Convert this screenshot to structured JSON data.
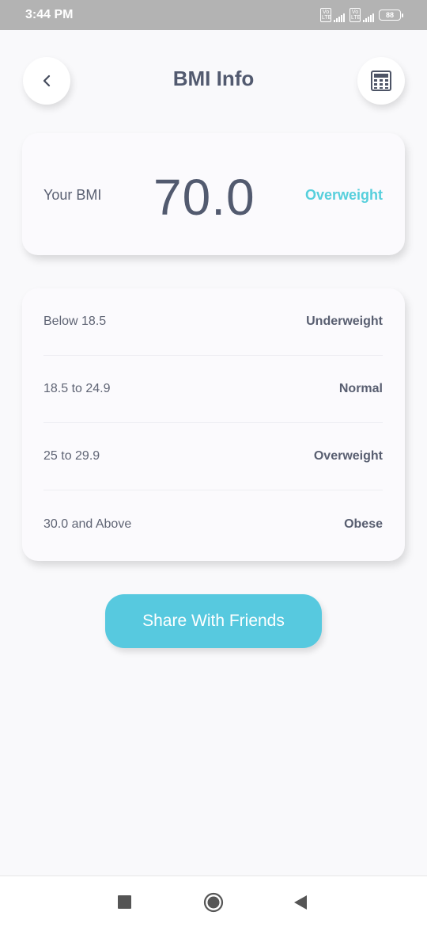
{
  "status_bar": {
    "time": "3:44 PM",
    "network_badge": "Vo LTE",
    "battery": "88"
  },
  "header": {
    "title": "BMI Info",
    "back_icon": "chevron-left-icon",
    "calculator_icon": "calculator-icon"
  },
  "bmi": {
    "label": "Your BMI",
    "value": "70.0",
    "status": "Overweight",
    "status_color": "#56cfdc"
  },
  "ranges": [
    {
      "range": "Below 18.5",
      "category": "Underweight"
    },
    {
      "range": "18.5 to 24.9",
      "category": "Normal"
    },
    {
      "range": "25 to 29.9",
      "category": "Overweight"
    },
    {
      "range": "30.0 and Above",
      "category": "Obese"
    }
  ],
  "share_button": {
    "label": "Share With Friends",
    "color": "#57c9df"
  },
  "nav": {
    "recent_icon": "square-recent-icon",
    "home_icon": "circle-home-icon",
    "back_icon": "triangle-back-icon"
  }
}
